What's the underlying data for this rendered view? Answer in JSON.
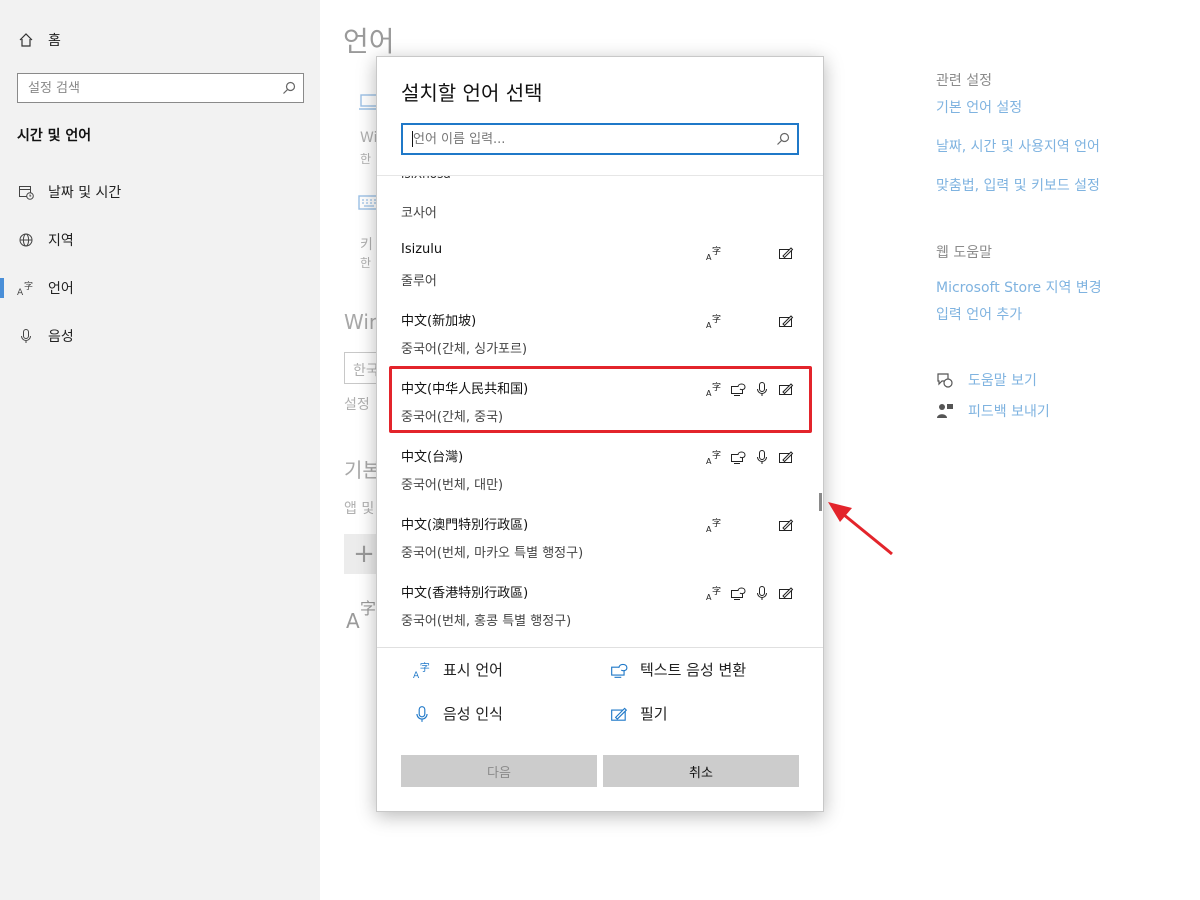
{
  "sidebar": {
    "home_label": "홈",
    "search_placeholder": "설정 검색",
    "section_title": "시간 및 언어",
    "items": [
      {
        "label": "날짜 및 시간",
        "icon": "calendar-clock-icon"
      },
      {
        "label": "지역",
        "icon": "globe-icon"
      },
      {
        "label": "언어",
        "icon": "language-icon",
        "active": true
      },
      {
        "label": "음성",
        "icon": "microphone-icon"
      }
    ]
  },
  "main": {
    "page_title": "언어",
    "fragments": {
      "win": "Wi",
      "han1": "한",
      "ki": "키",
      "han2": "한",
      "win2": "Win",
      "han3": "한국",
      "seol": "설정",
      "gibon": "기본",
      "aep": "앱 및"
    }
  },
  "related": {
    "heading": "관련 설정",
    "links": [
      "기본 언어 설정",
      "날짜, 시간 및 사용지역 언어",
      "맞춤법, 입력 및 키보드 설정"
    ],
    "help_heading": "웹 도움말",
    "help_links": [
      "Microsoft Store 지역 변경",
      "입력 언어 추가"
    ],
    "get_help": "도움말 보기",
    "feedback": "피드백 보내기"
  },
  "dialog": {
    "title": "설치할 언어 선택",
    "search_placeholder": "언어 이름 입력...",
    "partial_top": "isiXhosa",
    "first_korean": "코사어",
    "languages": [
      {
        "native": "Isizulu",
        "korean": "줄루어",
        "features": [
          "display",
          "handwriting"
        ]
      },
      {
        "native": "中文(新加坡)",
        "korean": "중국어(간체, 싱가포르)",
        "features": [
          "display",
          "handwriting"
        ]
      },
      {
        "native": "中文(中华人民共和国)",
        "korean": "중국어(간체, 중국)",
        "features": [
          "display",
          "tts",
          "speech",
          "handwriting"
        ],
        "highlighted": true
      },
      {
        "native": "中文(台灣)",
        "korean": "중국어(번체, 대만)",
        "features": [
          "display",
          "tts",
          "speech",
          "handwriting"
        ]
      },
      {
        "native": "中文(澳門特別行政區)",
        "korean": "중국어(번체, 마카오 특별 행정구)",
        "features": [
          "display",
          "handwriting"
        ]
      },
      {
        "native": "中文(香港特別行政區)",
        "korean": "중국어(번체, 홍콩 특별 행정구)",
        "features": [
          "display",
          "tts",
          "speech",
          "handwriting"
        ]
      }
    ],
    "legend": {
      "display": "표시 언어",
      "tts": "텍스트 음성 변환",
      "speech": "음성 인식",
      "handwriting": "필기"
    },
    "next_label": "다음",
    "cancel_label": "취소"
  },
  "colors": {
    "accent": "#1f78c8",
    "highlight": "#e3242b",
    "link": "#7fb3e0"
  }
}
